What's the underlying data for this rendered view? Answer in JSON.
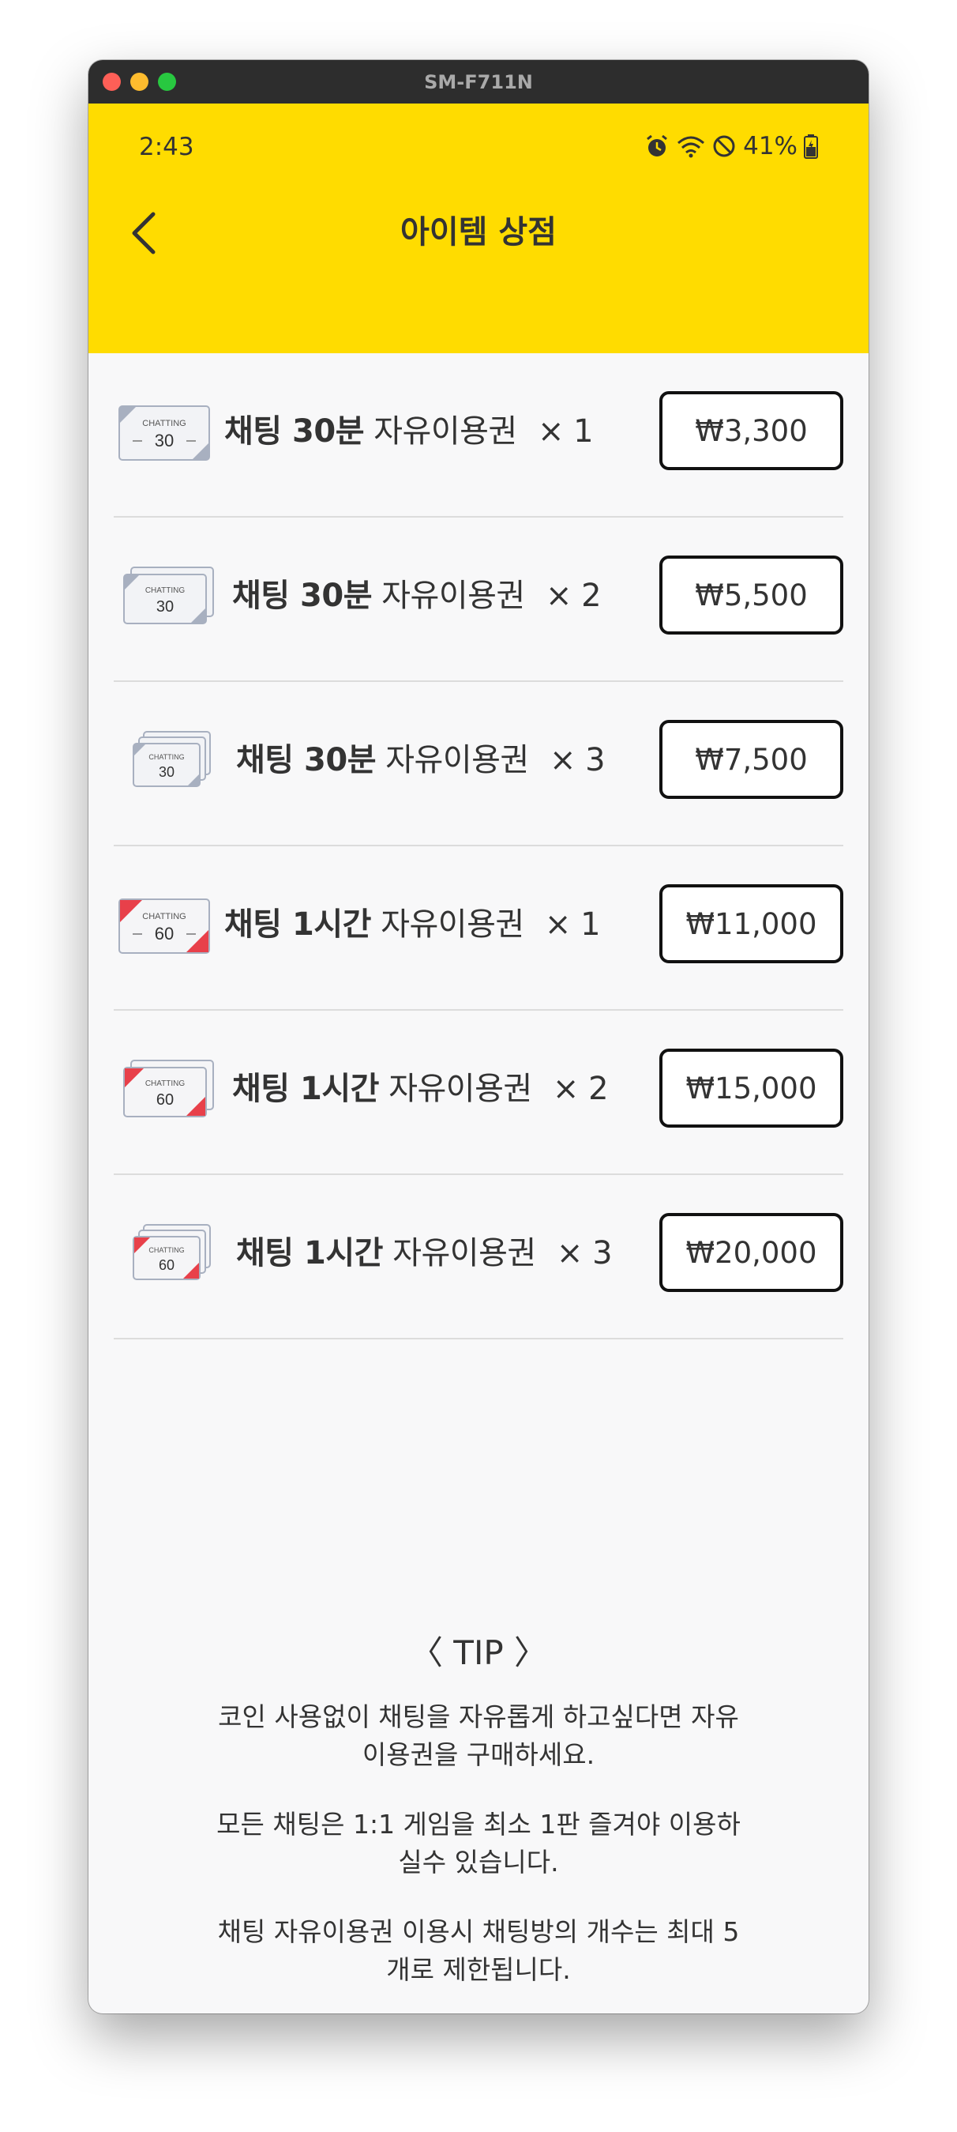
{
  "window": {
    "title": "SM-F711N"
  },
  "status_bar": {
    "time": "2:43",
    "battery": "41%"
  },
  "header": {
    "title": "아이템 상점"
  },
  "items": [
    {
      "ticket_label": "CHATTING",
      "ticket_number": "30",
      "name_bold": "채팅 30분",
      "name_rest": "자유이용권",
      "qty": "× 1",
      "price": "₩3,300"
    },
    {
      "ticket_label": "CHATTING",
      "ticket_number": "30",
      "name_bold": "채팅 30분",
      "name_rest": "자유이용권",
      "qty": "× 2",
      "price": "₩5,500"
    },
    {
      "ticket_label": "CHATTING",
      "ticket_number": "30",
      "name_bold": "채팅 30분",
      "name_rest": "자유이용권",
      "qty": "× 3",
      "price": "₩7,500"
    },
    {
      "ticket_label": "CHATTING",
      "ticket_number": "60",
      "name_bold": "채팅 1시간",
      "name_rest": "자유이용권",
      "qty": "× 1",
      "price": "₩11,000"
    },
    {
      "ticket_label": "CHATTING",
      "ticket_number": "60",
      "name_bold": "채팅 1시간",
      "name_rest": "자유이용권",
      "qty": "× 2",
      "price": "₩15,000"
    },
    {
      "ticket_label": "CHATTING",
      "ticket_number": "60",
      "name_bold": "채팅 1시간",
      "name_rest": "자유이용권",
      "qty": "× 3",
      "price": "₩20,000"
    }
  ],
  "tip": {
    "title": "〈 TIP 〉",
    "paragraphs": [
      "코인 사용없이 채팅을 자유롭게 하고싶다면 자유이용권을 구매하세요.",
      "모든 채팅은 1:1 게임을 최소 1판 즐겨야 이용하실수 있습니다.",
      "채팅 자유이용권 이용시 채팅방의 개수는 최대 5개로 제한됩니다."
    ]
  },
  "colors": {
    "header_bg": "#ffdc00",
    "ticket_30_stripe": "#a8b0c0",
    "ticket_60_stripe": "#e8404a"
  },
  "icons": [
    "back-chevron-icon",
    "alarm-icon",
    "wifi-icon",
    "do-not-disturb-icon",
    "battery-charging-icon",
    "ticket-icon"
  ]
}
